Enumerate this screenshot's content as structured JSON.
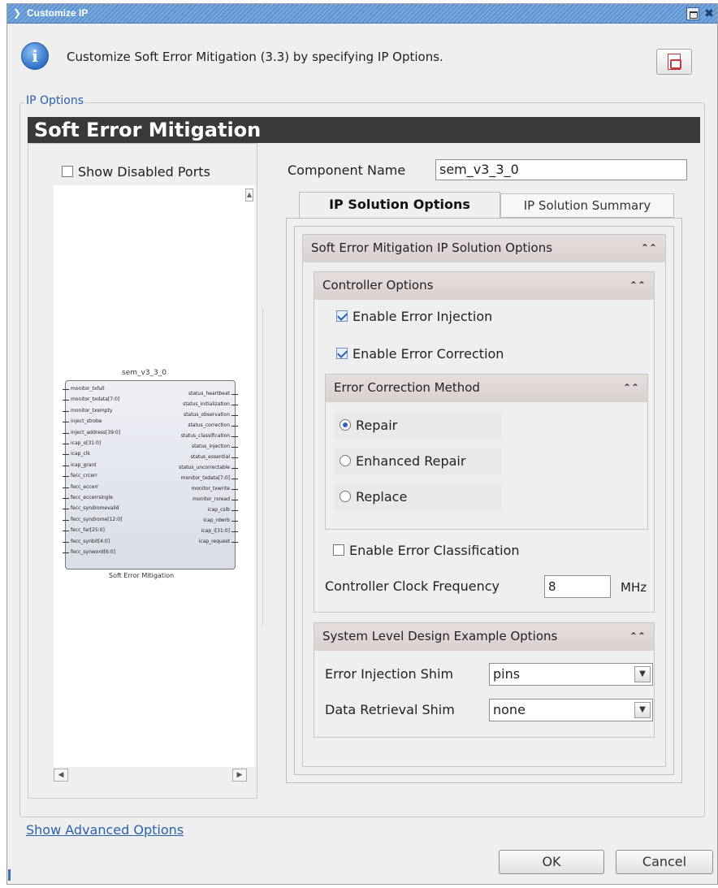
{
  "window": {
    "title": "Customize IP",
    "menu_glyph": "❯",
    "close_glyph": "✖"
  },
  "header": {
    "info_glyph": "i",
    "text": "Customize Soft Error Mitigation (3.3) by specifying IP Options."
  },
  "ip_options": {
    "legend": "IP Options"
  },
  "banner": {
    "title": "Soft Error Mitigation"
  },
  "symbol": {
    "show_disabled_ports": "Show Disabled Ports",
    "instance_name": "sem_v3_3_0",
    "caption": "Soft Error Mitigation",
    "left_ports": [
      "monitor_txfull",
      "monitor_txdata[7:0]",
      "monitor_txempty",
      "inject_strobe",
      "inject_address[39:0]",
      "icap_o[31:0]",
      "icap_clk",
      "icap_grant",
      "fecc_crcerr",
      "fecc_eccerr",
      "fecc_eccerrsingle",
      "fecc_syndromevalid",
      "fecc_syndrome[12:0]",
      "fecc_far[25:0]",
      "fecc_synbit[4:0]",
      "fecc_synword[6:0]"
    ],
    "right_ports": [
      "status_heartbeat",
      "status_initialization",
      "status_observation",
      "status_correction",
      "status_classification",
      "status_injection",
      "status_essential",
      "status_uncorrectable",
      "monitor_txdata[7:0]",
      "monitor_txwrite",
      "monitor_rxread",
      "icap_csib",
      "icap_rdwrb",
      "icap_i[31:0]",
      "icap_request"
    ]
  },
  "component": {
    "label": "Component Name",
    "value": "sem_v3_3_0"
  },
  "tabs": [
    {
      "label": "IP Solution Options"
    },
    {
      "label": "IP Solution Summary"
    }
  ],
  "solution_options": {
    "title": "Soft Error Mitigation IP Solution Options",
    "collapse_glyph": "⌃⌃",
    "controller": {
      "title": "Controller Options",
      "enable_injection": "Enable Error Injection",
      "enable_correction": "Enable Error Correction",
      "method": {
        "title": "Error Correction Method",
        "options": [
          {
            "label": "Repair",
            "selected": true
          },
          {
            "label": "Enhanced Repair",
            "selected": false
          },
          {
            "label": "Replace",
            "selected": false
          }
        ]
      },
      "enable_classification": "Enable Error Classification",
      "clock_label": "Controller Clock Frequency",
      "clock_value": "8",
      "clock_unit": "MHz"
    },
    "system_level": {
      "title": "System Level Design Example Options",
      "injection_shim_label": "Error Injection Shim",
      "injection_shim_value": "pins",
      "retrieval_shim_label": "Data Retrieval Shim",
      "retrieval_shim_value": "none"
    }
  },
  "footer": {
    "advanced_link": "Show Advanced Options",
    "ok": "OK",
    "cancel": "Cancel"
  }
}
